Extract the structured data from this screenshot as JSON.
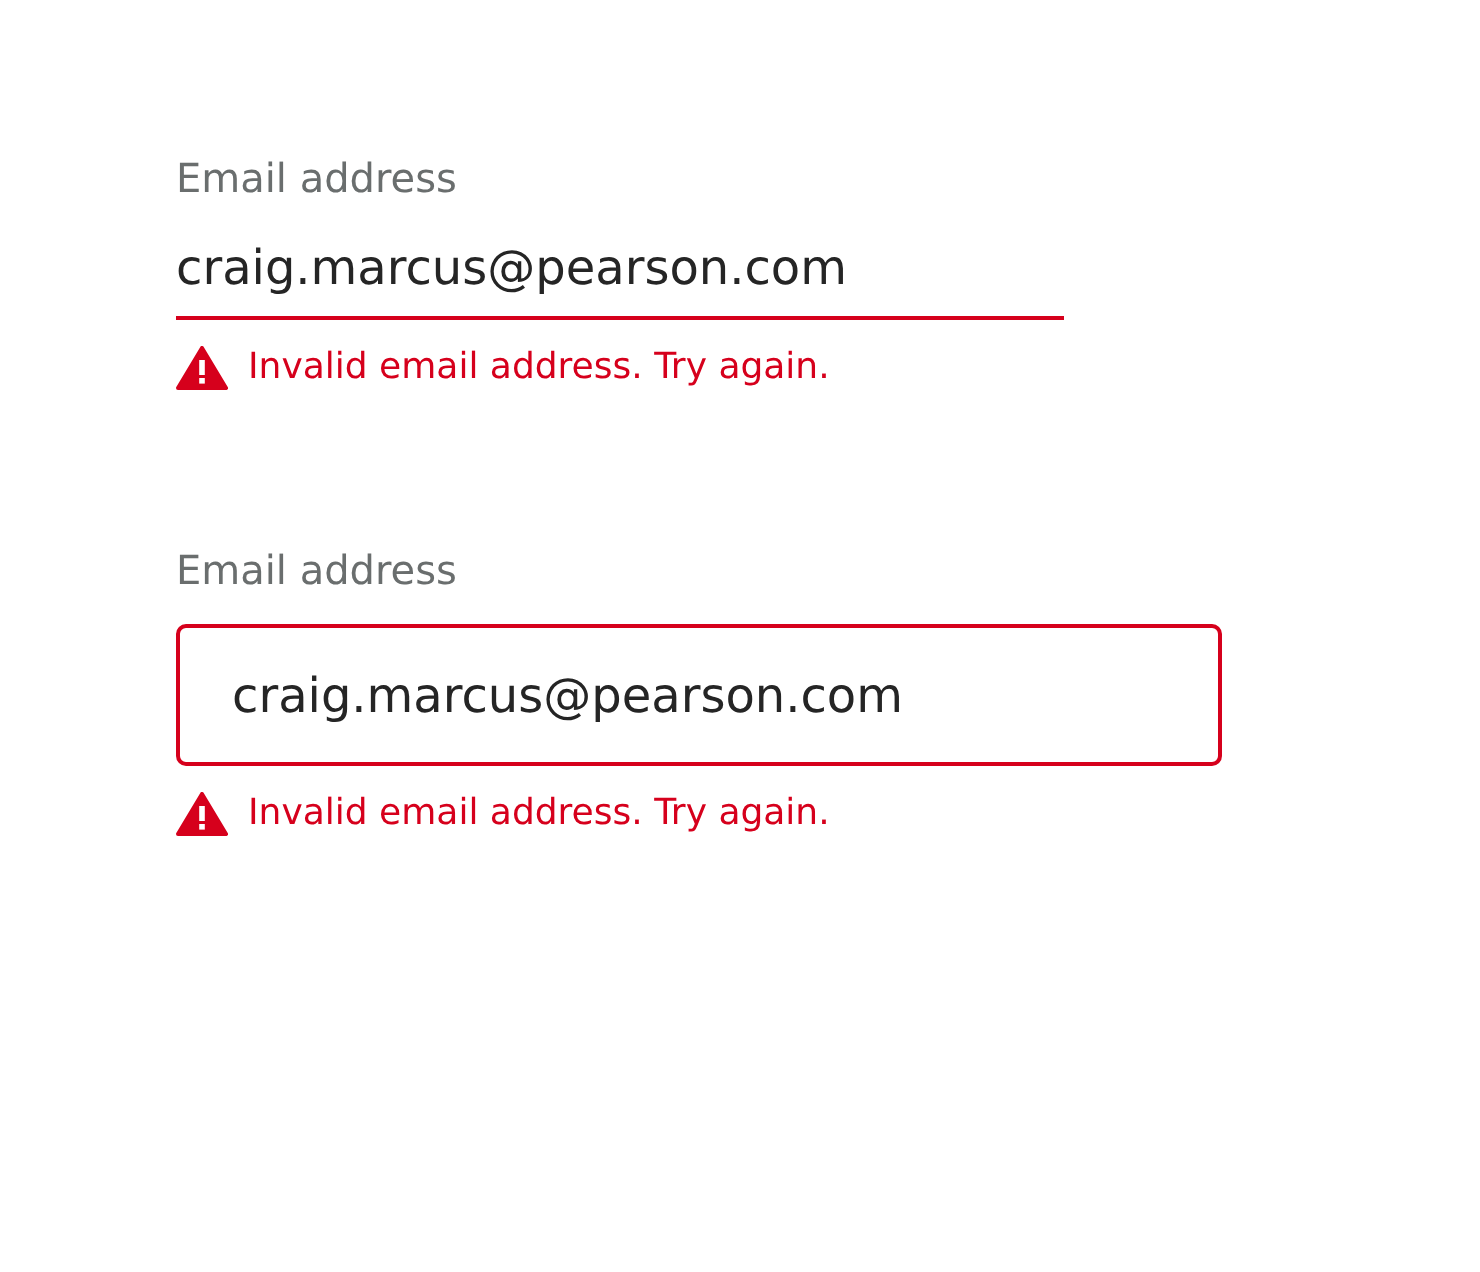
{
  "fields": [
    {
      "kind": "underline",
      "label": "Email address",
      "value": "craig.marcus@pearson.com",
      "invalid": true,
      "error": "Invalid email address. Try again."
    },
    {
      "kind": "outlined",
      "label": "Email address",
      "value": "craig.marcus@pearson.com",
      "invalid": true,
      "error": "Invalid email address. Try again."
    }
  ]
}
